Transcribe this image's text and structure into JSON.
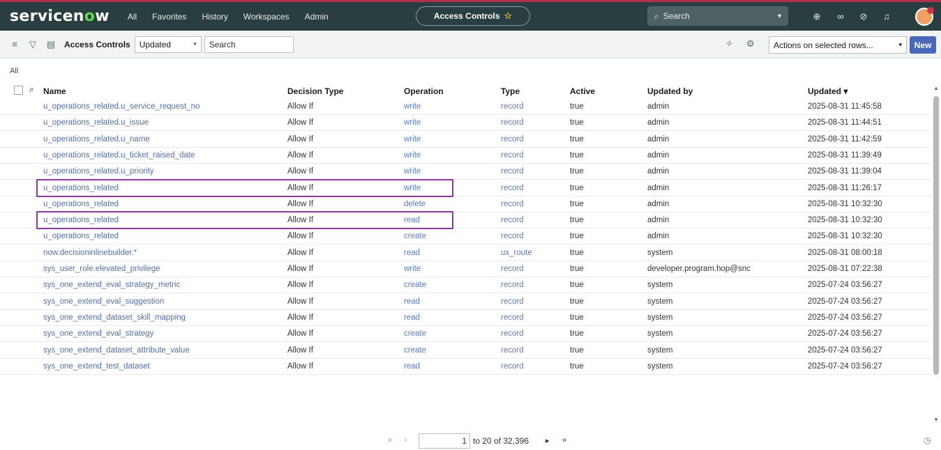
{
  "topnav": {
    "logo_pre": "servicen",
    "logo_o": "o",
    "logo_post": "w",
    "items": [
      "All",
      "Favorites",
      "History",
      "Workspaces",
      "Admin"
    ],
    "tab_title": "Access Controls",
    "search_placeholder": "Search"
  },
  "listbar": {
    "title": "Access Controls",
    "field_select": "Updated",
    "search_placeholder": "Search",
    "actions_select": "Actions on selected rows...",
    "new_label": "New"
  },
  "breadcrumb": "All",
  "table": {
    "headers": [
      "Name",
      "Decision Type",
      "Operation",
      "Type",
      "Active",
      "Updated by",
      "Updated ▾"
    ],
    "rows": [
      {
        "name": "u_operations_related.u_service_request_no",
        "decision": "Allow If",
        "operation": "write",
        "type": "record",
        "active": "true",
        "updated_by": "admin",
        "updated": "2025-08-31 11:45:58"
      },
      {
        "name": "u_operations_related.u_issue",
        "decision": "Allow If",
        "operation": "write",
        "type": "record",
        "active": "true",
        "updated_by": "admin",
        "updated": "2025-08-31 11:44:51"
      },
      {
        "name": "u_operations_related.u_name",
        "decision": "Allow If",
        "operation": "write",
        "type": "record",
        "active": "true",
        "updated_by": "admin",
        "updated": "2025-08-31 11:42:59"
      },
      {
        "name": "u_operations_related.u_ticket_raised_date",
        "decision": "Allow If",
        "operation": "write",
        "type": "record",
        "active": "true",
        "updated_by": "admin",
        "updated": "2025-08-31 11:39:49"
      },
      {
        "name": "u_operations_related.u_priority",
        "decision": "Allow If",
        "operation": "write",
        "type": "record",
        "active": "true",
        "updated_by": "admin",
        "updated": "2025-08-31 11:39:04"
      },
      {
        "name": "u_operations_related",
        "decision": "Allow If",
        "operation": "write",
        "type": "record",
        "active": "true",
        "updated_by": "admin",
        "updated": "2025-08-31 11:26:17"
      },
      {
        "name": "u_operations_related",
        "decision": "Allow If",
        "operation": "delete",
        "type": "record",
        "active": "true",
        "updated_by": "admin",
        "updated": "2025-08-31 10:32:30"
      },
      {
        "name": "u_operations_related",
        "decision": "Allow If",
        "operation": "read",
        "type": "record",
        "active": "true",
        "updated_by": "admin",
        "updated": "2025-08-31 10:32:30"
      },
      {
        "name": "u_operations_related",
        "decision": "Allow If",
        "operation": "create",
        "type": "record",
        "active": "true",
        "updated_by": "admin",
        "updated": "2025-08-31 10:32:30"
      },
      {
        "name": "now.decisioninlinebuilder.*",
        "decision": "Allow If",
        "operation": "read",
        "type": "ux_route",
        "active": "true",
        "updated_by": "system",
        "updated": "2025-08-31 08:00:18"
      },
      {
        "name": "sys_user_role.elevated_privilege",
        "decision": "Allow If",
        "operation": "write",
        "type": "record",
        "active": "true",
        "updated_by": "developer.program.hop@snc",
        "updated": "2025-08-31 07:22:38"
      },
      {
        "name": "sys_one_extend_eval_strategy_metric",
        "decision": "Allow If",
        "operation": "create",
        "type": "record",
        "active": "true",
        "updated_by": "system",
        "updated": "2025-07-24 03:56:27"
      },
      {
        "name": "sys_one_extend_eval_suggestion",
        "decision": "Allow If",
        "operation": "read",
        "type": "record",
        "active": "true",
        "updated_by": "system",
        "updated": "2025-07-24 03:56:27"
      },
      {
        "name": "sys_one_extend_dataset_skill_mapping",
        "decision": "Allow If",
        "operation": "read",
        "type": "record",
        "active": "true",
        "updated_by": "system",
        "updated": "2025-07-24 03:56:27"
      },
      {
        "name": "sys_one_extend_eval_strategy",
        "decision": "Allow If",
        "operation": "create",
        "type": "record",
        "active": "true",
        "updated_by": "system",
        "updated": "2025-07-24 03:56:27"
      },
      {
        "name": "sys_one_extend_dataset_attribute_value",
        "decision": "Allow If",
        "operation": "create",
        "type": "record",
        "active": "true",
        "updated_by": "system",
        "updated": "2025-07-24 03:56:27"
      },
      {
        "name": "sys_one_extend_test_dataset",
        "decision": "Allow If",
        "operation": "read",
        "type": "record",
        "active": "true",
        "updated_by": "system",
        "updated": "2025-07-24 03:56:27"
      }
    ]
  },
  "pager": {
    "first_icon": "«",
    "prev_icon": "‹",
    "page_value": "1",
    "range_text": "to 20 of 32,396",
    "next_icon": "▸",
    "last_icon": "»"
  }
}
